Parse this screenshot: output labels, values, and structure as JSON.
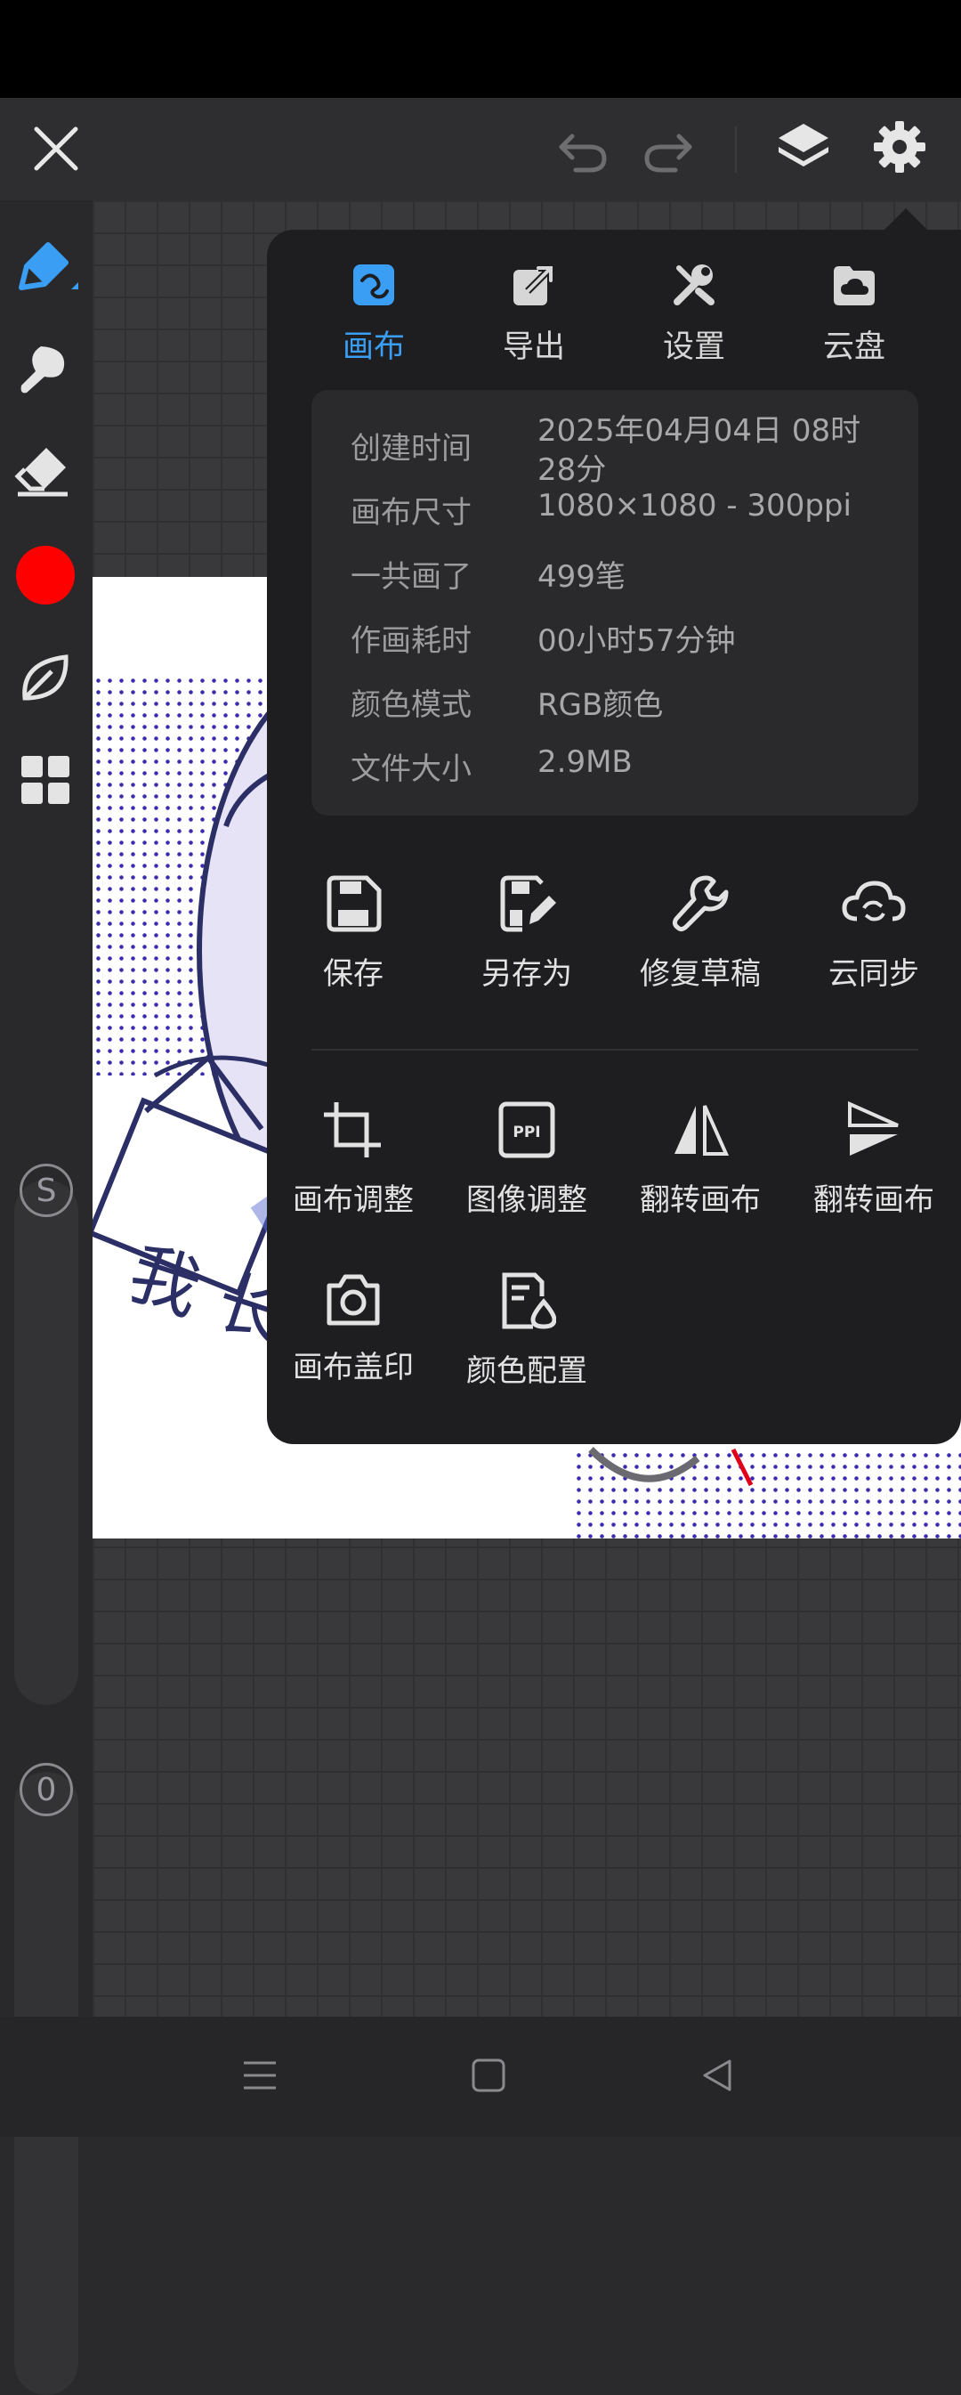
{
  "colors": {
    "accent": "#3a9ef4",
    "brush_color": "#ff0000",
    "popup_bg": "#1e1e20"
  },
  "toolbar": {
    "icons": [
      "close-icon",
      "undo-icon",
      "redo-icon",
      "layers-icon",
      "gear-icon"
    ]
  },
  "left_tools": [
    "pen-icon",
    "smudge-icon",
    "eraser-icon",
    "color-swatch",
    "leaf-icon",
    "grid-icon"
  ],
  "sliders": {
    "size_label": "S",
    "opacity_label": "0"
  },
  "artwork": {
    "sign_text": "我 长"
  },
  "popup": {
    "tabs": [
      {
        "label": "画布",
        "icon": "canvas-icon",
        "active": true
      },
      {
        "label": "导出",
        "icon": "export-icon"
      },
      {
        "label": "设置",
        "icon": "tools-icon"
      },
      {
        "label": "云盘",
        "icon": "cloud-drive-icon"
      }
    ],
    "info": [
      {
        "key": "创建时间",
        "value": "2025年04月04日 08时28分"
      },
      {
        "key": "画布尺寸",
        "value": "1080×1080 - 300ppi"
      },
      {
        "key": "一共画了",
        "value": "499笔"
      },
      {
        "key": "作画耗时",
        "value": "00小时57分钟"
      },
      {
        "key": "颜色模式",
        "value": "RGB颜色"
      },
      {
        "key": "文件大小",
        "value": "2.9MB"
      }
    ],
    "actions_row1": [
      {
        "label": "保存",
        "icon": "save-icon"
      },
      {
        "label": "另存为",
        "icon": "save-as-icon"
      },
      {
        "label": "修复草稿",
        "icon": "wrench-icon"
      },
      {
        "label": "云同步",
        "icon": "cloud-sync-icon"
      }
    ],
    "actions_row2": [
      {
        "label": "画布调整",
        "icon": "crop-icon"
      },
      {
        "label": "图像调整",
        "icon": "ppi-icon",
        "icon_text": "PPI"
      },
      {
        "label": "翻转画布",
        "icon": "flip-horizontal-icon"
      },
      {
        "label": "翻转画布",
        "icon": "flip-vertical-icon"
      }
    ],
    "actions_row3": [
      {
        "label": "画布盖印",
        "icon": "camera-icon"
      },
      {
        "label": "颜色配置",
        "icon": "color-config-icon"
      }
    ]
  },
  "navbar": [
    "menu-icon",
    "home-icon",
    "back-icon"
  ]
}
